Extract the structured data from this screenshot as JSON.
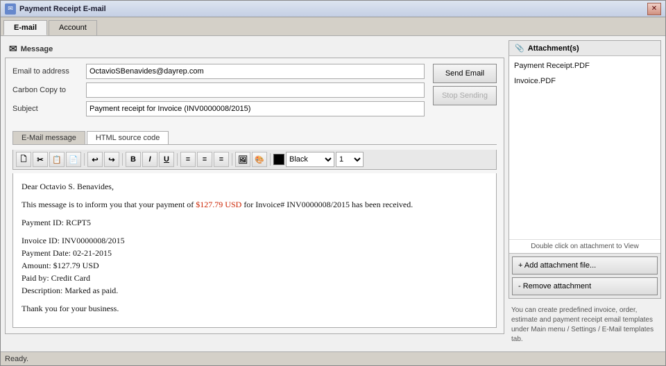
{
  "window": {
    "title": "Payment Receipt E-mail",
    "close_label": "✕"
  },
  "tabs": [
    {
      "label": "E-mail",
      "active": true
    },
    {
      "label": "Account",
      "active": false
    }
  ],
  "section": {
    "icon": "✉",
    "label": "Message"
  },
  "form": {
    "email_to_label": "Email to address",
    "email_to_value": "OctavioSBenavides@dayrep.com",
    "cc_label": "Carbon Copy to",
    "cc_value": "",
    "subject_label": "Subject",
    "subject_value": "Payment receipt for Invoice (INV0000008/2015)"
  },
  "buttons": {
    "send_email": "Send Email",
    "stop_sending": "Stop Sending"
  },
  "editor": {
    "tab_message": "E-Mail message",
    "tab_source": "HTML source code",
    "toolbar": {
      "bold": "B",
      "italic": "I",
      "underline": "U",
      "align_left": "≡",
      "align_center": "≡",
      "align_right": "≡",
      "image": "🖼",
      "color": "🎨",
      "font_color_label": "Black",
      "font_size_value": "1"
    },
    "body_lines": [
      {
        "type": "text",
        "content": "Dear Octavio S. Benavides,"
      },
      {
        "type": "blank"
      },
      {
        "type": "mixed",
        "before": "This message is to inform you that your payment of ",
        "highlight": "$127.79 USD",
        "after": " for Invoice# INV0000008/2015 has been received."
      },
      {
        "type": "blank"
      },
      {
        "type": "text",
        "content": "Payment ID: RCPT5"
      },
      {
        "type": "text",
        "content": "Invoice ID: INV0000008/2015"
      },
      {
        "type": "text",
        "content": "Payment Date: 02-21-2015"
      },
      {
        "type": "text",
        "content": "Amount: $127.79 USD"
      },
      {
        "type": "text",
        "content": "Paid by: Credit Card"
      },
      {
        "type": "text",
        "content": "Description: Marked as paid."
      },
      {
        "type": "blank"
      },
      {
        "type": "text",
        "content": "Thank you for your business."
      }
    ]
  },
  "attachments": {
    "header_icon": "📎",
    "header_label": "Attachment(s)",
    "files": [
      "Payment Receipt.PDF",
      "Invoice.PDF"
    ],
    "hint": "Double click on attachment to View",
    "add_btn": "+ Add attachment file...",
    "remove_btn": "- Remove attachment",
    "info": "You can create predefined invoice, order, estimate and payment receipt email templates under Main menu / Settings / E-Mail templates tab."
  },
  "status_bar": {
    "text": "Ready."
  }
}
